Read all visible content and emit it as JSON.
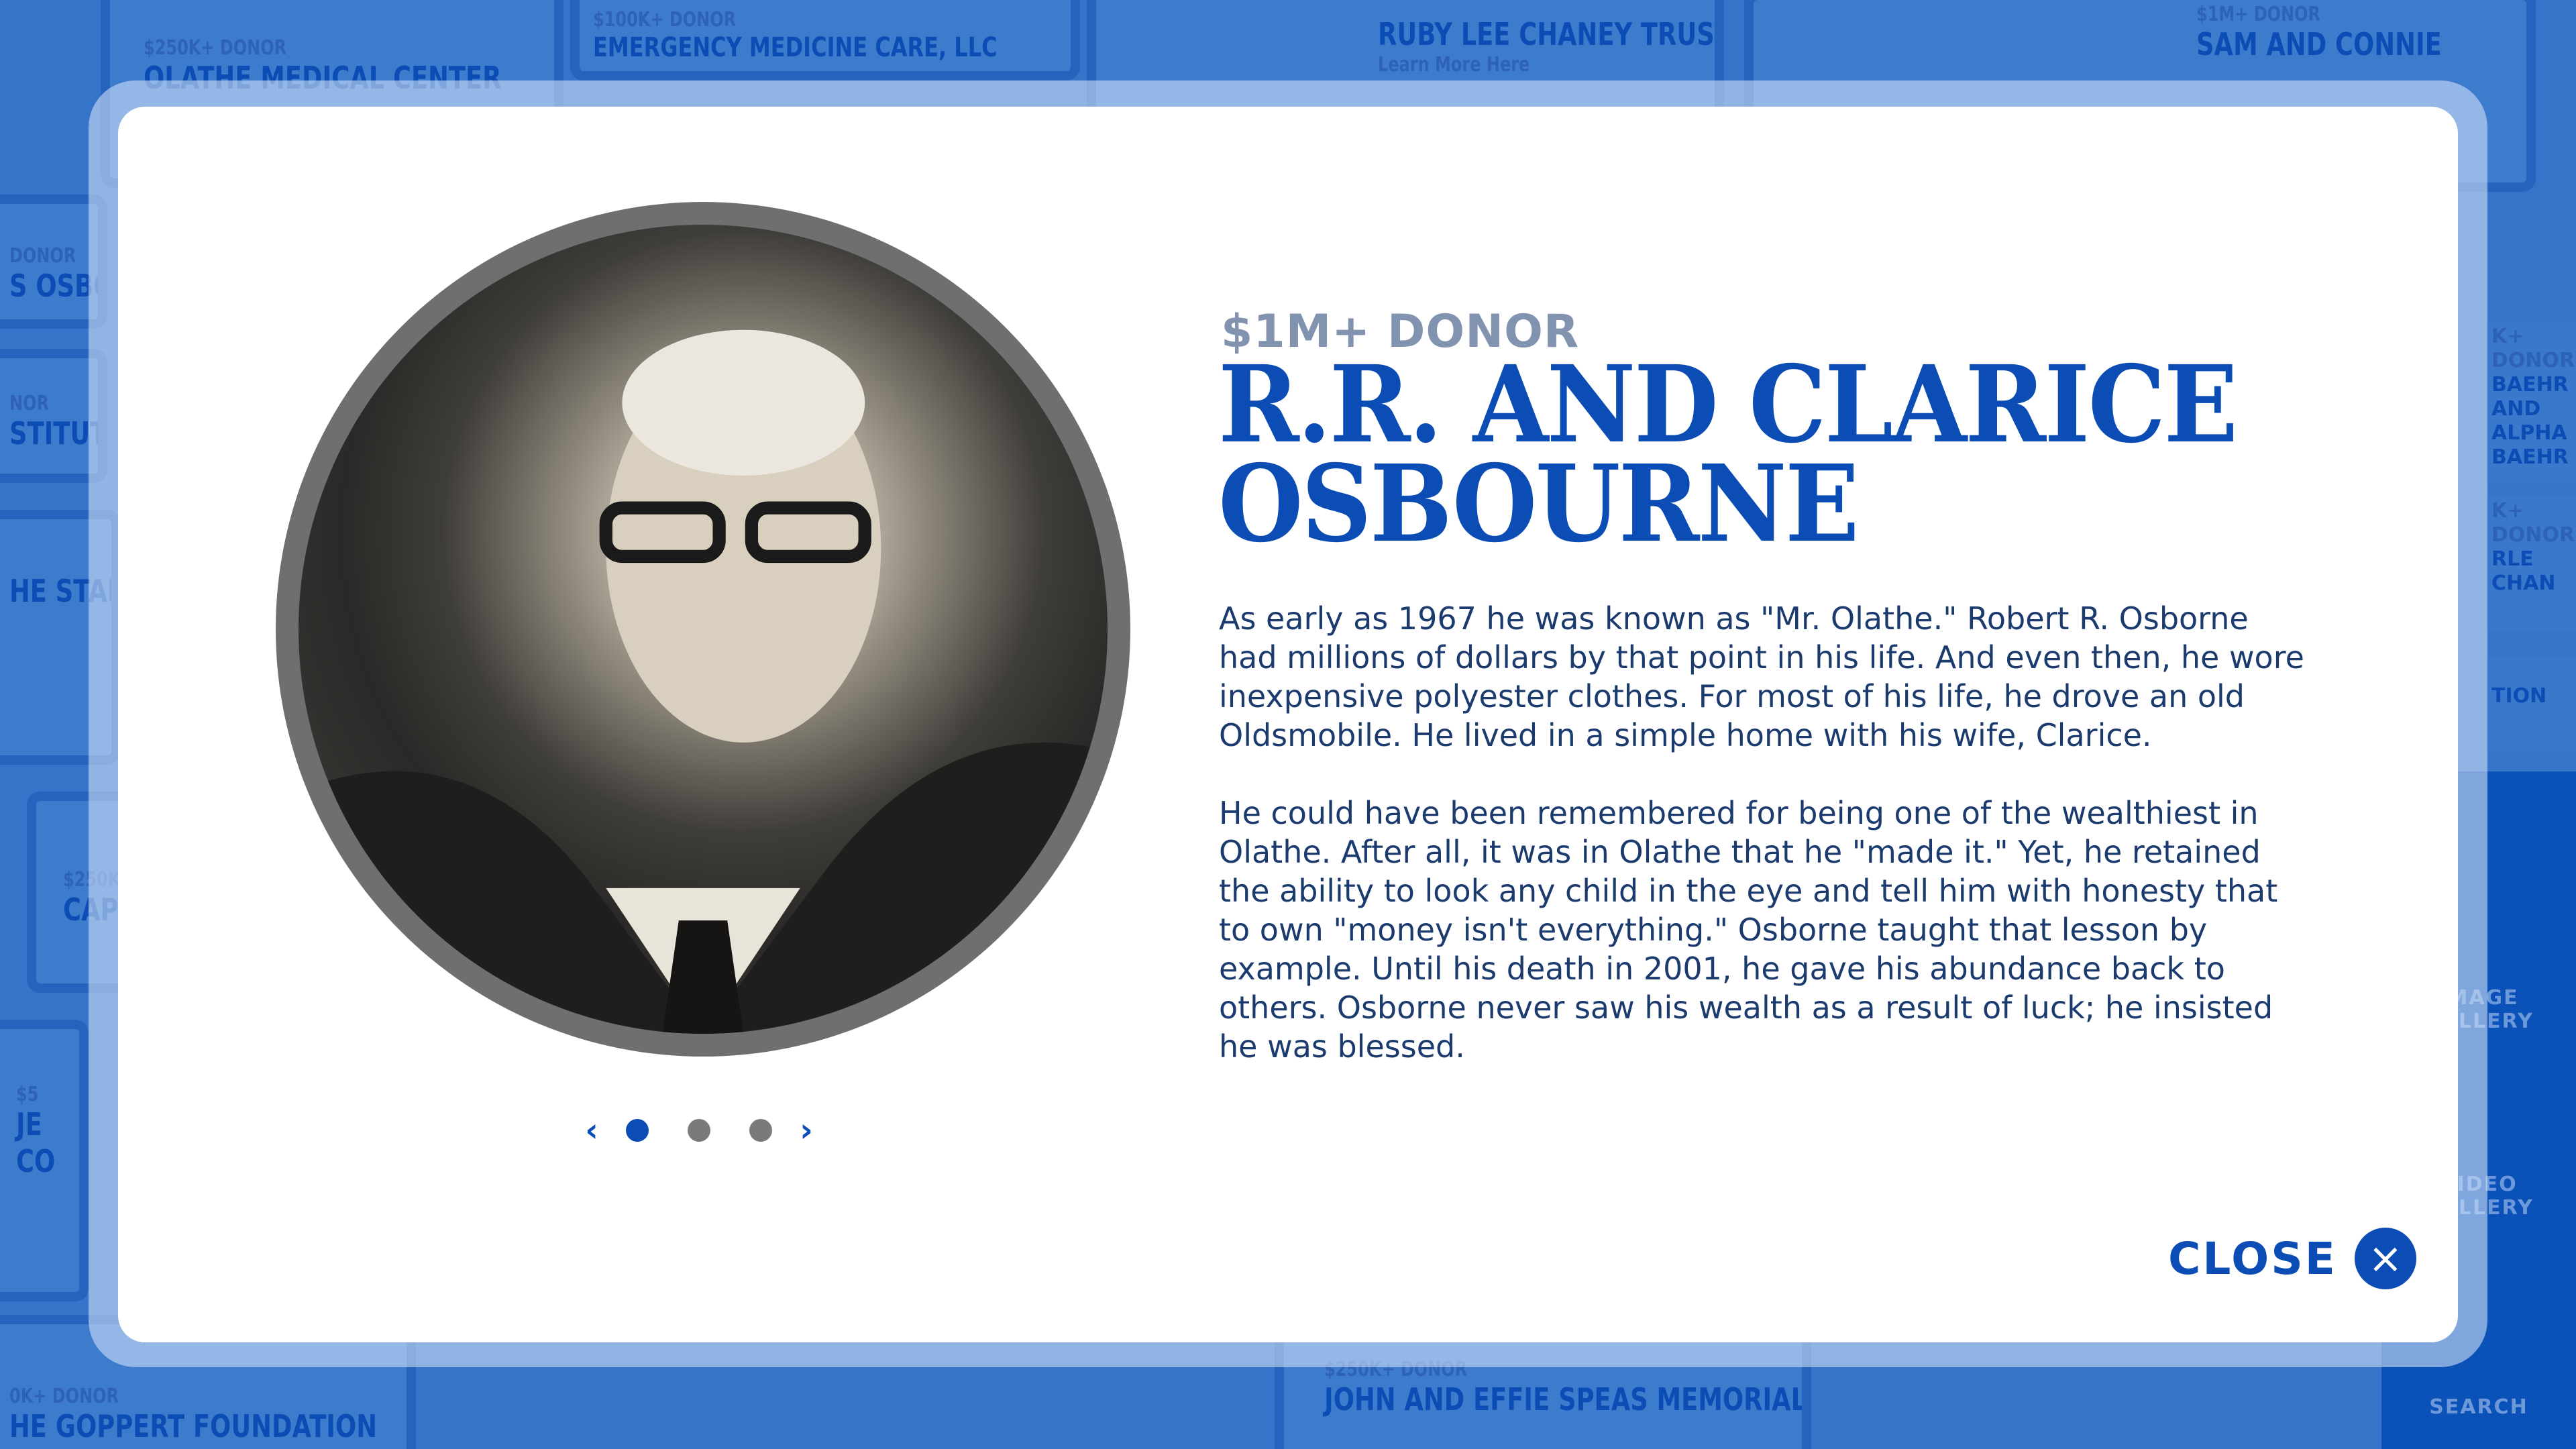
{
  "background": {
    "tiles": [
      {
        "level": "$250K+ DONOR",
        "name": "OLATHE MEDICAL CENTER"
      },
      {
        "level": "$100K+ DONOR",
        "name": "EMERGENCY MEDICINE CARE, LLC"
      },
      {
        "level": "",
        "name": "RUBY LEE CHANEY TRUST",
        "link": "Learn More Here"
      },
      {
        "level": "$1M+ DONOR",
        "name": "SAM AND CONNIE"
      },
      {
        "level": "DONOR",
        "name": "S OSBORN"
      },
      {
        "level": "NOR",
        "name": "STITUTE"
      },
      {
        "level": "",
        "name": "HE STAR SCHOLARSHIP"
      },
      {
        "level": "$250K+",
        "name": "CAP"
      },
      {
        "level": "$5",
        "name": "JE CO"
      },
      {
        "level": "0K+ DONOR",
        "name": "HE GOPPERT FOUNDATION"
      },
      {
        "level": "$250K+ DONOR",
        "name": "JOHN AND EFFIE SPEAS MEMORIAL TRUST,"
      },
      {
        "level": "K+ DONOR",
        "name": "BAEHR AND ALPHA BAEHR"
      },
      {
        "level": "K+ DONOR",
        "name": "RLE CHAN"
      },
      {
        "level": "",
        "name": "TION"
      }
    ],
    "sidebar": {
      "image_gallery": "IMAGE GALLERY",
      "video_gallery": "VIDEO GALLERY",
      "search": "SEARCH"
    }
  },
  "modal": {
    "level": "$1M+ DONOR",
    "name_line1": "R.R. AND CLARICE",
    "name_line2": "OSBOURNE",
    "bio": [
      "As early as 1967 he was known as \"Mr. Olathe.\" Robert R. Osborne had millions of dollars by that point in his life. And even then, he wore inexpensive polyester clothes. For most of his life, he drove an old Oldsmobile. He lived in a simple home with his wife, Clarice.",
      "He could have been remembered for being one of the wealthiest in Olathe. After all, it was in Olathe that he \"made it.\" Yet, he retained the ability to look any child in the eye and tell him with honesty that to own \"money isn't everything.\" Osborne taught that lesson by example. Until his death in 2001, he gave his abundance back to others. Osborne never saw his wealth as a result of luck; he insisted he was blessed."
    ],
    "pager": {
      "current": 1,
      "total": 3,
      "prev": "‹",
      "next": "›"
    },
    "close_label": "CLOSE",
    "close_icon": "×"
  },
  "colors": {
    "accent": "#0b4db5",
    "level": "#8293b0",
    "background": "#3574c8"
  }
}
